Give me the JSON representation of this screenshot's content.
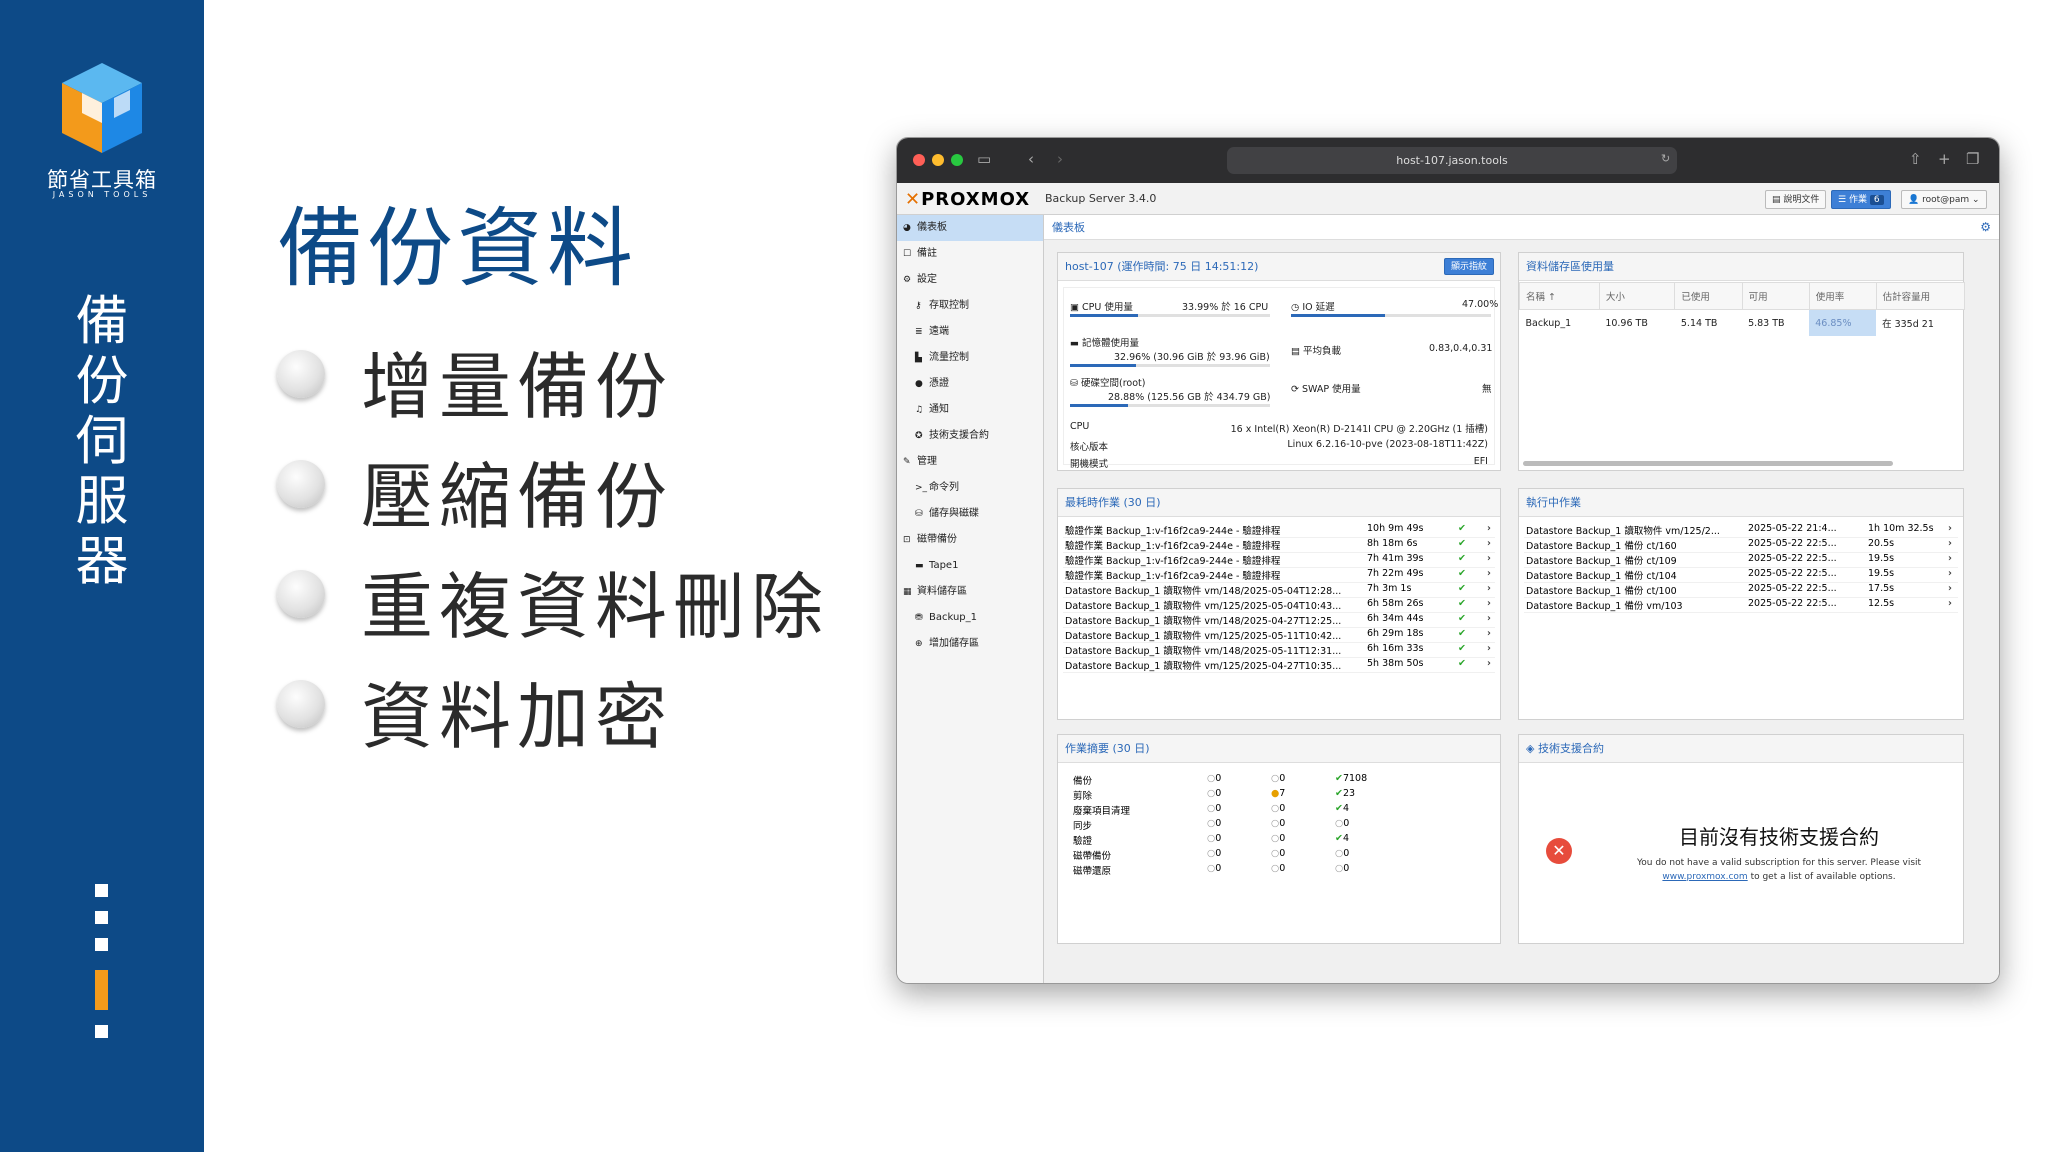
{
  "slide": {
    "brand_cn": "節省工具箱",
    "brand_en": "JASON TOOLS",
    "vertical_title": [
      "備",
      "份",
      "伺",
      "服",
      "器"
    ],
    "title": "備份資料",
    "bullets": [
      "增量備份",
      "壓縮備份",
      "重複資料刪除",
      "資料加密"
    ],
    "accent_color": "#0d4a87",
    "highlight_color": "#f39a1b"
  },
  "browser": {
    "url": "host-107.jason.tools"
  },
  "app": {
    "logo": "PROXMOX",
    "version": "Backup Server 3.4.0",
    "header_buttons": {
      "docs": "說明文件",
      "tasks": "作業",
      "task_count": "6",
      "user": "root@pam"
    },
    "nav": [
      {
        "label": "儀表板",
        "icon": "dashboard-icon",
        "sub": false,
        "selected": true
      },
      {
        "label": "備註",
        "icon": "notes-icon",
        "sub": false
      },
      {
        "label": "設定",
        "icon": "gears-icon",
        "sub": false
      },
      {
        "label": "存取控制",
        "icon": "key-icon",
        "sub": true
      },
      {
        "label": "遠端",
        "icon": "server-icon",
        "sub": true
      },
      {
        "label": "流量控制",
        "icon": "chart-icon",
        "sub": true
      },
      {
        "label": "憑證",
        "icon": "certificate-icon",
        "sub": true
      },
      {
        "label": "通知",
        "icon": "bell-icon",
        "sub": true
      },
      {
        "label": "技術支援合約",
        "icon": "support-icon",
        "sub": true
      },
      {
        "label": "管理",
        "icon": "wrench-icon",
        "sub": false
      },
      {
        "label": "命令列",
        "icon": "terminal-icon",
        "sub": true
      },
      {
        "label": "儲存與磁碟",
        "icon": "disk-icon",
        "sub": true
      },
      {
        "label": "磁帶備份",
        "icon": "tape-icon",
        "sub": false
      },
      {
        "label": "Tape1",
        "icon": "tape-drive-icon",
        "sub": true
      },
      {
        "label": "資料儲存區",
        "icon": "archive-icon",
        "sub": false
      },
      {
        "label": "Backup_1",
        "icon": "database-icon",
        "sub": true
      },
      {
        "label": "增加儲存區",
        "icon": "plus-circle-icon",
        "sub": true
      }
    ],
    "breadcrumb": "儀表板",
    "host_panel": {
      "title": "host-107 (運作時間: 75 日 14:51:12)",
      "button": "顯示指紋",
      "cpu_label": "CPU 使用量",
      "cpu_value": "33.99% 於 16 CPU",
      "cpu_fraction": 0.34,
      "io_label": "IO 延遲",
      "io_value": "47.00%",
      "io_fraction": 0.47,
      "mem_label": "記憶體使用量",
      "mem_value": "32.96% (30.96 GiB 於 93.96 GiB)",
      "mem_fraction": 0.33,
      "load_label": "平均負載",
      "load_value": "0.83,0.4,0.31",
      "disk_label": "硬碟空間(root)",
      "disk_value": "28.88% (125.56 GB 於 434.79 GB)",
      "disk_fraction": 0.29,
      "swap_label": "SWAP 使用量",
      "swap_value": "無",
      "cpu_model_label": "CPU",
      "cpu_model": "16 x Intel(R) Xeon(R) D-2141I CPU @ 2.20GHz (1 插槽)",
      "kernel_label": "核心版本",
      "kernel": "Linux 6.2.16-10-pve (2023-08-18T11:42Z)",
      "boot_label": "開機模式",
      "boot": "EFI"
    },
    "storage_panel": {
      "title": "資料儲存區使用量",
      "headers": [
        "名稱 ↑",
        "大小",
        "已使用",
        "可用",
        "使用率",
        "估計容量用"
      ],
      "rows": [
        [
          "Backup_1",
          "10.96 TB",
          "5.14 TB",
          "5.83 TB",
          "46.85%",
          "在 335d 21"
        ]
      ]
    },
    "longest_tasks": {
      "title": "最耗時作業 (30 日)",
      "rows": [
        [
          "驗證作業 Backup_1:v-f16f2ca9-244e - 驗證排程",
          "10h 9m 49s"
        ],
        [
          "驗證作業 Backup_1:v-f16f2ca9-244e - 驗證排程",
          "8h 18m 6s"
        ],
        [
          "驗證作業 Backup_1:v-f16f2ca9-244e - 驗證排程",
          "7h 41m 39s"
        ],
        [
          "驗證作業 Backup_1:v-f16f2ca9-244e - 驗證排程",
          "7h 22m 49s"
        ],
        [
          "Datastore Backup_1 讀取物件 vm/148/2025-05-04T12:28...",
          "7h 3m 1s"
        ],
        [
          "Datastore Backup_1 讀取物件 vm/125/2025-05-04T10:43...",
          "6h 58m 26s"
        ],
        [
          "Datastore Backup_1 讀取物件 vm/148/2025-04-27T12:25...",
          "6h 34m 44s"
        ],
        [
          "Datastore Backup_1 讀取物件 vm/125/2025-05-11T10:42...",
          "6h 29m 18s"
        ],
        [
          "Datastore Backup_1 讀取物件 vm/148/2025-05-11T12:31...",
          "6h 16m 33s"
        ],
        [
          "Datastore Backup_1 讀取物件 vm/125/2025-04-27T10:35...",
          "5h 38m 50s"
        ]
      ]
    },
    "running_tasks": {
      "title": "執行中作業",
      "rows": [
        [
          "Datastore Backup_1 讀取物件 vm/125/2...",
          "2025-05-22 21:4...",
          "1h 10m 32.5s"
        ],
        [
          "Datastore Backup_1 備份 ct/160",
          "2025-05-22 22:5...",
          "20.5s"
        ],
        [
          "Datastore Backup_1 備份 ct/109",
          "2025-05-22 22:5...",
          "19.5s"
        ],
        [
          "Datastore Backup_1 備份 ct/104",
          "2025-05-22 22:5...",
          "19.5s"
        ],
        [
          "Datastore Backup_1 備份 ct/100",
          "2025-05-22 22:5...",
          "17.5s"
        ],
        [
          "Datastore Backup_1 備份 vm/103",
          "2025-05-22 22:5...",
          "12.5s"
        ]
      ]
    },
    "task_summary": {
      "title": "作業摘要 (30 日)",
      "rows": [
        [
          "備份",
          "0",
          "0",
          "7108"
        ],
        [
          "剪除",
          "0",
          "7",
          "23"
        ],
        [
          "廢棄項目清理",
          "0",
          "0",
          "4"
        ],
        [
          "同步",
          "0",
          "0",
          "0"
        ],
        [
          "驗證",
          "0",
          "0",
          "4"
        ],
        [
          "磁帶備份",
          "0",
          "0",
          "0"
        ],
        [
          "磁帶還原",
          "0",
          "0",
          "0"
        ]
      ]
    },
    "subscription": {
      "title": "技術支援合約",
      "heading": "目前沒有技術支援合約",
      "line1": "You do not have a valid subscription for this server. Please visit",
      "link": "www.proxmox.com",
      "line2": " to get a list of available options."
    }
  }
}
